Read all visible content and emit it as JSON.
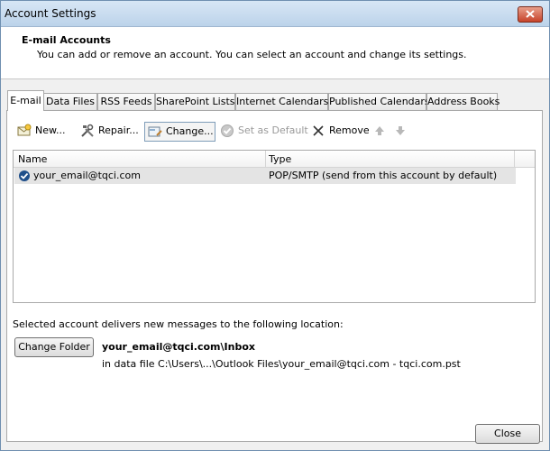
{
  "window": {
    "title": "Account Settings"
  },
  "header": {
    "title": "E-mail Accounts",
    "subtitle": "You can add or remove an account. You can select an account and change its settings."
  },
  "tabs": [
    {
      "label": "E-mail",
      "active": true
    },
    {
      "label": "Data Files"
    },
    {
      "label": "RSS Feeds"
    },
    {
      "label": "SharePoint Lists"
    },
    {
      "label": "Internet Calendars"
    },
    {
      "label": "Published Calendars"
    },
    {
      "label": "Address Books"
    }
  ],
  "toolbar": {
    "new_label": "New...",
    "repair_label": "Repair...",
    "change_label": "Change...",
    "set_default_label": "Set as Default",
    "remove_label": "Remove",
    "move_up_icon": "arrow-up-icon",
    "move_down_icon": "arrow-down-icon"
  },
  "accounts_table": {
    "columns": [
      "Name",
      "Type"
    ],
    "rows": [
      {
        "name": "your_email@tqci.com",
        "type": "POP/SMTP (send from this account by default)"
      }
    ]
  },
  "delivery": {
    "description": "Selected account delivers new messages to the following location:",
    "change_folder_label": "Change Folder",
    "inbox_path": "your_email@tqci.com\\Inbox",
    "data_file": "in data file C:\\Users\\...\\Outlook Files\\your_email@tqci.com - tqci.com.pst"
  },
  "footer": {
    "close_label": "Close"
  },
  "colors": {
    "titlebar": "#bcd3ea",
    "close_red": "#c7432a",
    "selected_row": "#e4e4e4"
  }
}
